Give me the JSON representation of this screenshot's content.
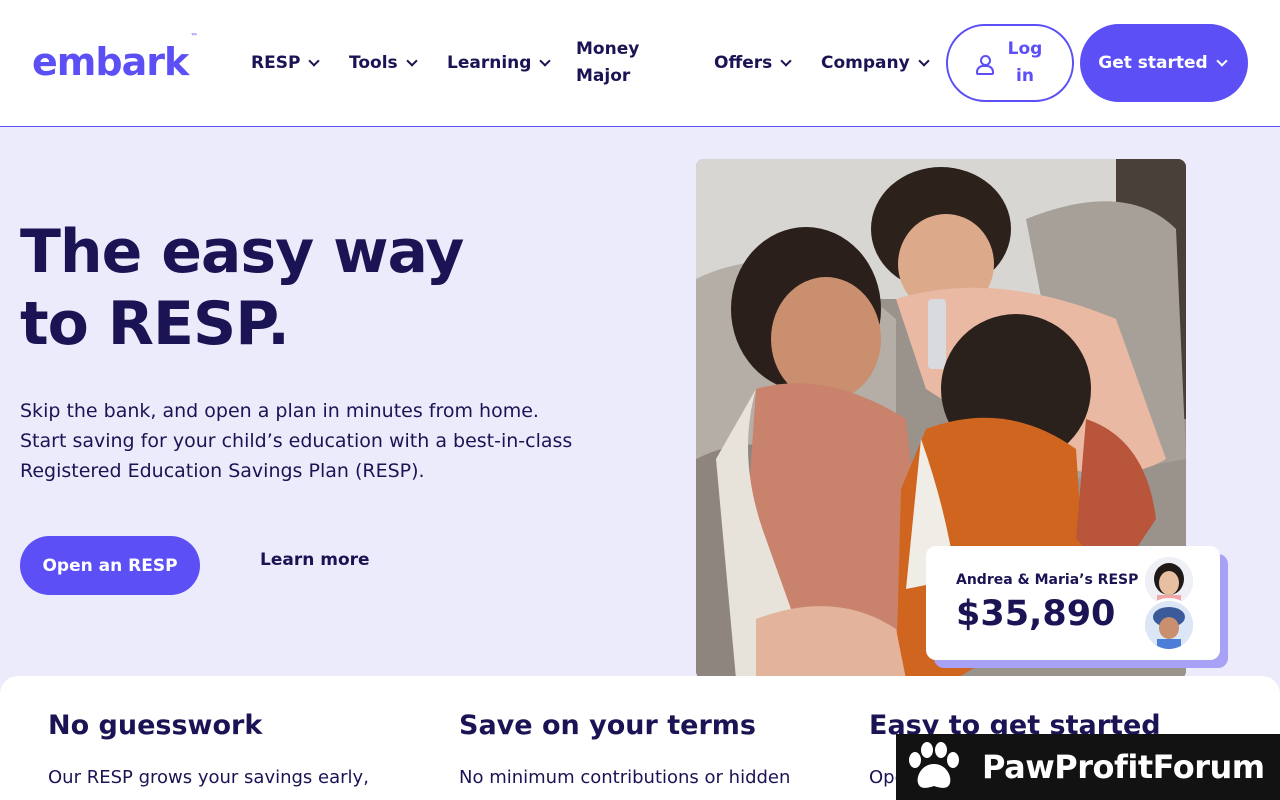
{
  "brand": {
    "logo_text": "embark",
    "trademark": "™",
    "accent": "#5b4ff5",
    "navy": "#1a1454"
  },
  "nav": {
    "items": [
      {
        "label": "RESP",
        "has_dropdown": true
      },
      {
        "label": "Tools",
        "has_dropdown": true
      },
      {
        "label": "Learning",
        "has_dropdown": true
      },
      {
        "label": "Money Major",
        "has_dropdown": false
      },
      {
        "label": "Offers",
        "has_dropdown": true
      },
      {
        "label": "Company",
        "has_dropdown": true
      }
    ],
    "login_label": "Log in",
    "get_started_label": "Get started"
  },
  "hero": {
    "title_line1": "The easy way",
    "title_line2": "to RESP.",
    "subtitle_lines": [
      "Skip the bank, and open a plan in minutes from home.",
      "Start saving for your child’s education with a best-in-class",
      "Registered Education Savings Plan (RESP)."
    ],
    "primary_cta": "Open an RESP",
    "secondary_cta": "Learn more"
  },
  "resp_card": {
    "label": "Andrea & Maria’s RESP",
    "amount": "$35,890"
  },
  "features": [
    {
      "title": "No guesswork",
      "text": "Our RESP grows your savings early,"
    },
    {
      "title": "Save on your terms",
      "text": "No minimum contributions or hidden"
    },
    {
      "title": "Easy to get started",
      "text": "Open"
    }
  ],
  "watermark": {
    "text": "PawProfitForum"
  }
}
